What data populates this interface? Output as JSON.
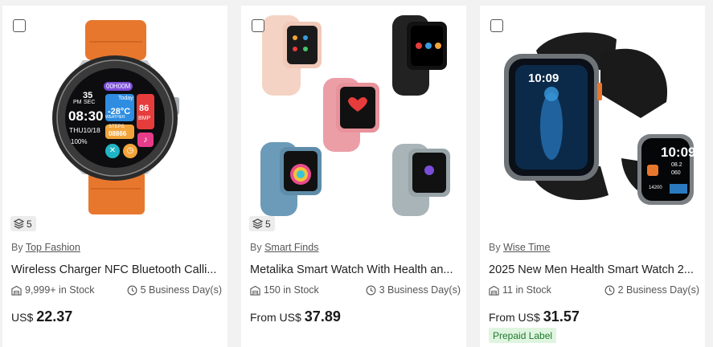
{
  "labels": {
    "by_prefix": "By",
    "currency": "US$",
    "from_prefix": "From"
  },
  "products": [
    {
      "variant_count": "5",
      "seller": "Top Fashion",
      "title": "Wireless Charger NFC Bluetooth Calli...",
      "stock": "9,999+ in Stock",
      "ship": "5 Business Day(s)",
      "price_prefix": "US$",
      "price": "22.37",
      "watch_face": {
        "time_small": "35",
        "sec_label": "SEC",
        "pm_label": "PM",
        "time": "08:30",
        "date": "THU10/18",
        "battery": "100%",
        "weather": "Today",
        "temp": "-28°C",
        "bpm_value": "86",
        "bpm_label": "BMP",
        "steps_label": "STEPS",
        "steps": "08866",
        "weather_label": "WEATHER",
        "alarm": "00H00M"
      }
    },
    {
      "variant_count": "5",
      "seller": "Smart Finds",
      "title": "Metalika Smart Watch With Health an...",
      "stock": "150 in Stock",
      "ship": "3 Business Day(s)",
      "price_prefix": "From US$",
      "price": "37.89"
    },
    {
      "seller": "Wise Time",
      "title": "2025 New Men Health Smart Watch 2...",
      "stock": "11 in Stock",
      "ship": "2 Business Day(s)",
      "price_prefix": "From US$",
      "price": "31.57",
      "prepaid": "Prepaid Label",
      "watch_face": {
        "big_time": "10:09",
        "small_time": "10:09",
        "stat1": "08.2",
        "stat2": "060",
        "stat3": "14200"
      }
    }
  ],
  "colors": {
    "strap_orange": "#e8772e",
    "prepaid_bg": "#dff5df",
    "prepaid_text": "#1f7a2f"
  }
}
